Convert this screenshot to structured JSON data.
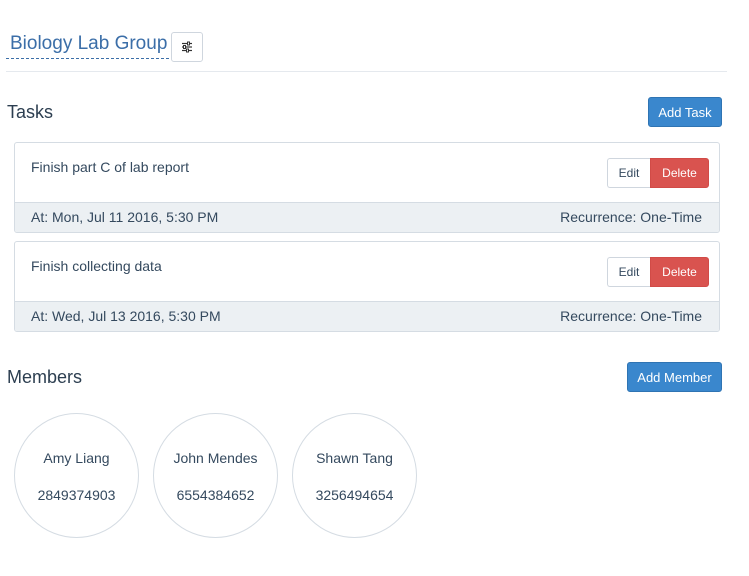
{
  "group": {
    "title": "Biology Lab Group",
    "settings_icon": "sliders-icon"
  },
  "tasks_section": {
    "title": "Tasks",
    "add_label": "Add Task",
    "items": [
      {
        "title": "Finish part C of lab report",
        "when": "At: Mon, Jul 11 2016, 5:30 PM",
        "recurrence": "Recurrence: One-Time",
        "edit_label": "Edit",
        "delete_label": "Delete"
      },
      {
        "title": "Finish collecting data",
        "when": "At: Wed, Jul 13 2016, 5:30 PM",
        "recurrence": "Recurrence: One-Time",
        "edit_label": "Edit",
        "delete_label": "Delete"
      }
    ]
  },
  "members_section": {
    "title": "Members",
    "add_label": "Add Member",
    "items": [
      {
        "name": "Amy Liang",
        "phone": "2849374903"
      },
      {
        "name": "John Mendes",
        "phone": "6554384652"
      },
      {
        "name": "Shawn Tang",
        "phone": "3256494654"
      }
    ]
  },
  "colors": {
    "primary": "#3a87cd",
    "danger": "#d9534f",
    "link": "#3b6ea8",
    "footer_bg": "#ecf0f3"
  }
}
